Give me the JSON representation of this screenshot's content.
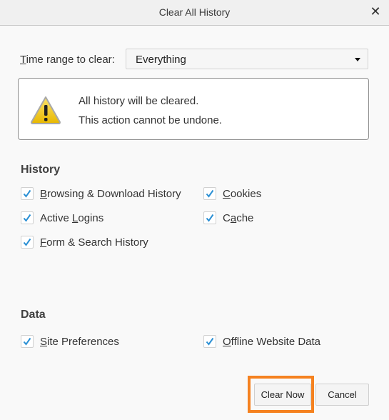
{
  "dialog": {
    "title": "Clear All History",
    "close_icon": "close-icon"
  },
  "time_range": {
    "label_first": "T",
    "label_rest": "ime range to clear:",
    "selected": "Everything"
  },
  "warning": {
    "icon": "warning-triangle-icon",
    "line1": "All history will be cleared.",
    "line2": "This action cannot be undone."
  },
  "history": {
    "title": "History",
    "items": [
      {
        "pre": "",
        "u": "B",
        "post": "rowsing & Download History",
        "checked": true
      },
      {
        "pre": "",
        "u": "C",
        "post": "ookies",
        "checked": true
      },
      {
        "pre": "Active ",
        "u": "L",
        "post": "ogins",
        "checked": true
      },
      {
        "pre": "C",
        "u": "a",
        "post": "che",
        "checked": true
      },
      {
        "pre": "",
        "u": "F",
        "post": "orm & Search History",
        "checked": true
      }
    ]
  },
  "data": {
    "title": "Data",
    "items": [
      {
        "pre": "",
        "u": "S",
        "post": "ite Preferences",
        "checked": true
      },
      {
        "pre": "",
        "u": "O",
        "post": "ffline Website Data",
        "checked": true
      }
    ]
  },
  "buttons": {
    "clear_now": "Clear Now",
    "cancel": "Cancel"
  },
  "colors": {
    "highlight": "#f58220",
    "check": "#2a8fd4",
    "warning_fill": "#f2c812"
  }
}
